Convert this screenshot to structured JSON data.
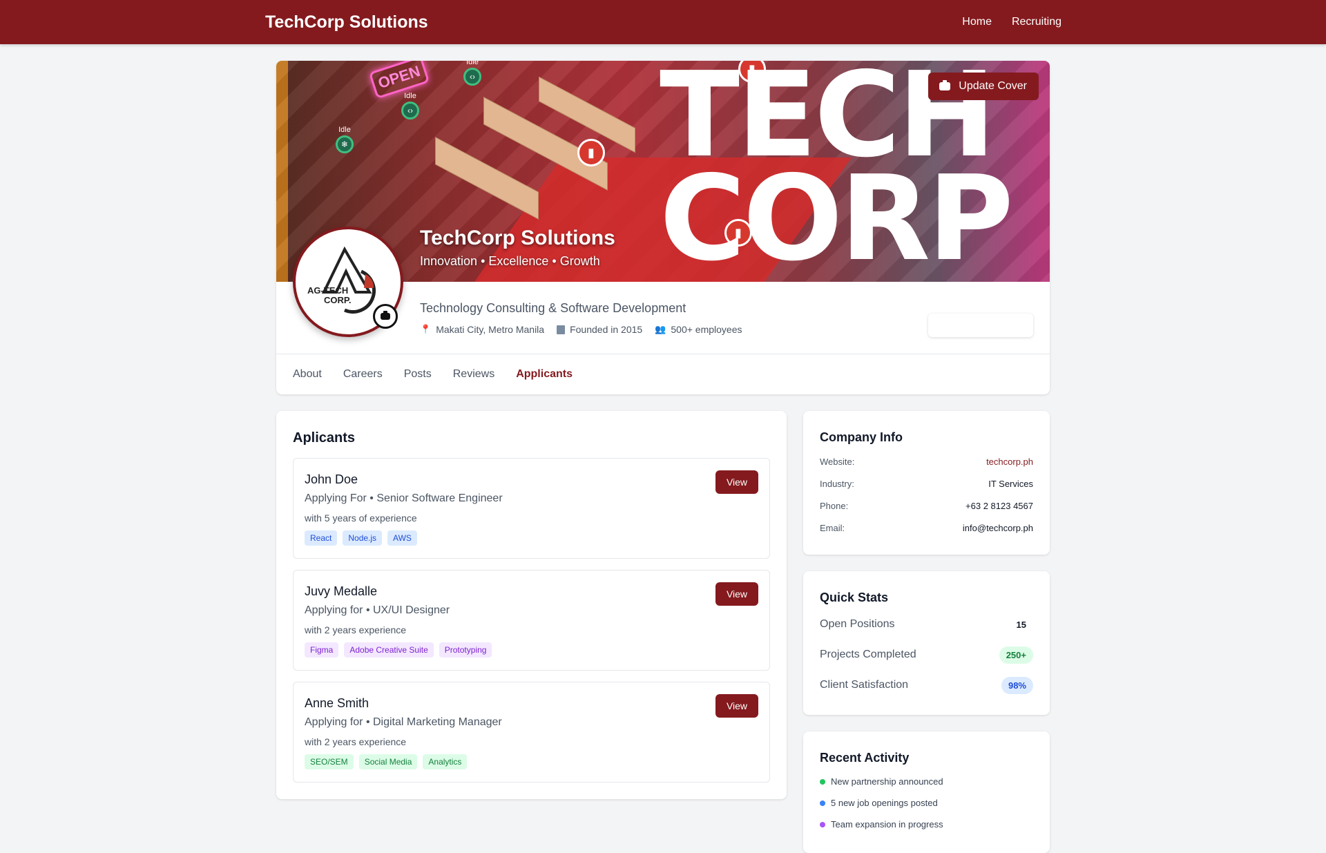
{
  "nav": {
    "brand": "TechCorp Solutions",
    "links": [
      "Home",
      "Recruiting"
    ]
  },
  "cover": {
    "big_text_line1": "TECH",
    "big_text_line2": "CORP",
    "title": "TechCorp Solutions",
    "tagline": "Innovation • Excellence • Growth",
    "update_button": "Update Cover",
    "neon_sign": "OPEN",
    "idle_label": "Idle"
  },
  "avatar": {
    "logo_text_line1": "AG-TECH",
    "logo_text_line2": "CORP."
  },
  "company": {
    "industry": "Technology Consulting & Software Development",
    "location": "Makati City, Metro Manila",
    "founded": "Founded in 2015",
    "employees": "500+ employees"
  },
  "tabs": [
    {
      "label": "About",
      "active": false
    },
    {
      "label": "Careers",
      "active": false
    },
    {
      "label": "Posts",
      "active": false
    },
    {
      "label": "Reviews",
      "active": false
    },
    {
      "label": "Applicants",
      "active": true
    }
  ],
  "applicants": {
    "title": "Aplicants",
    "view_label": "View",
    "items": [
      {
        "name": "John Doe",
        "role": "Applying For • Senior Software Engineer",
        "experience": "with 5 years of experience",
        "tags": [
          "React",
          "Node.js",
          "AWS"
        ],
        "tag_color": "blue"
      },
      {
        "name": "Juvy Medalle",
        "role": "Applying for • UX/UI Designer",
        "experience": "with 2 years experience",
        "tags": [
          "Figma",
          "Adobe Creative Suite",
          "Prototyping"
        ],
        "tag_color": "purple"
      },
      {
        "name": "Anne Smith",
        "role": "Applying for • Digital Marketing Manager",
        "experience": "with 2 years experience",
        "tags": [
          "SEO/SEM",
          "Social Media",
          "Analytics"
        ],
        "tag_color": "green"
      }
    ]
  },
  "company_info": {
    "title": "Company Info",
    "rows": [
      {
        "label": "Website:",
        "value": "techcorp.ph"
      },
      {
        "label": "Industry:",
        "value": "IT Services"
      },
      {
        "label": "Phone:",
        "value": "+63 2 8123 4567"
      },
      {
        "label": "Email:",
        "value": "info@techcorp.ph"
      }
    ]
  },
  "quick_stats": {
    "title": "Quick Stats",
    "rows": [
      {
        "label": "Open Positions",
        "value": "15"
      },
      {
        "label": "Projects Completed",
        "value": "250+"
      },
      {
        "label": "Client Satisfaction",
        "value": "98%"
      }
    ]
  },
  "recent_activity": {
    "title": "Recent Activity",
    "items": [
      {
        "text": "New partnership announced",
        "color": "#22c55e"
      },
      {
        "text": "5 new job openings posted",
        "color": "#3b82f6"
      },
      {
        "text": "Team expansion in progress",
        "color": "#a855f7"
      }
    ]
  },
  "colors": {
    "brand": "#841a1e"
  }
}
